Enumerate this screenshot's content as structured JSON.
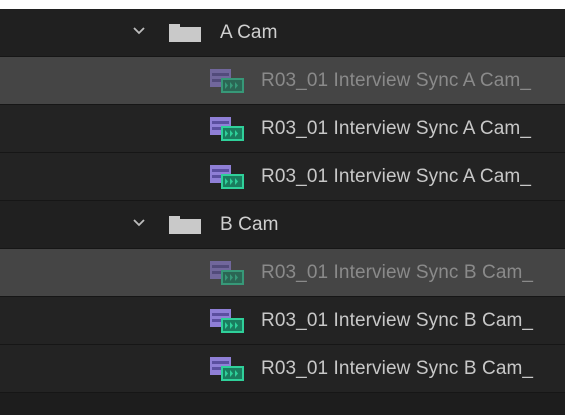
{
  "bins": [
    {
      "name": "A Cam",
      "clips": [
        {
          "name": "R03_01 Interview Sync A Cam_",
          "selected": true
        },
        {
          "name": "R03_01 Interview Sync A Cam_",
          "selected": false
        },
        {
          "name": "R03_01 Interview Sync A Cam_",
          "selected": false
        }
      ]
    },
    {
      "name": "B Cam",
      "clips": [
        {
          "name": "R03_01 Interview Sync B Cam_",
          "selected": true
        },
        {
          "name": "R03_01 Interview Sync B Cam_",
          "selected": false
        },
        {
          "name": "R03_01 Interview Sync B Cam_",
          "selected": false
        }
      ]
    }
  ],
  "icons": {
    "disclosure": "chevron-down-icon",
    "bin": "folder-icon",
    "clip": "video-clip-icon"
  },
  "colors": {
    "panel_bg": "#1d1d1d",
    "selected_row": "#454545",
    "clip_icon_purple": "#8f7fd6",
    "clip_icon_green": "#2fd09a",
    "text": "#cfcfcf"
  }
}
